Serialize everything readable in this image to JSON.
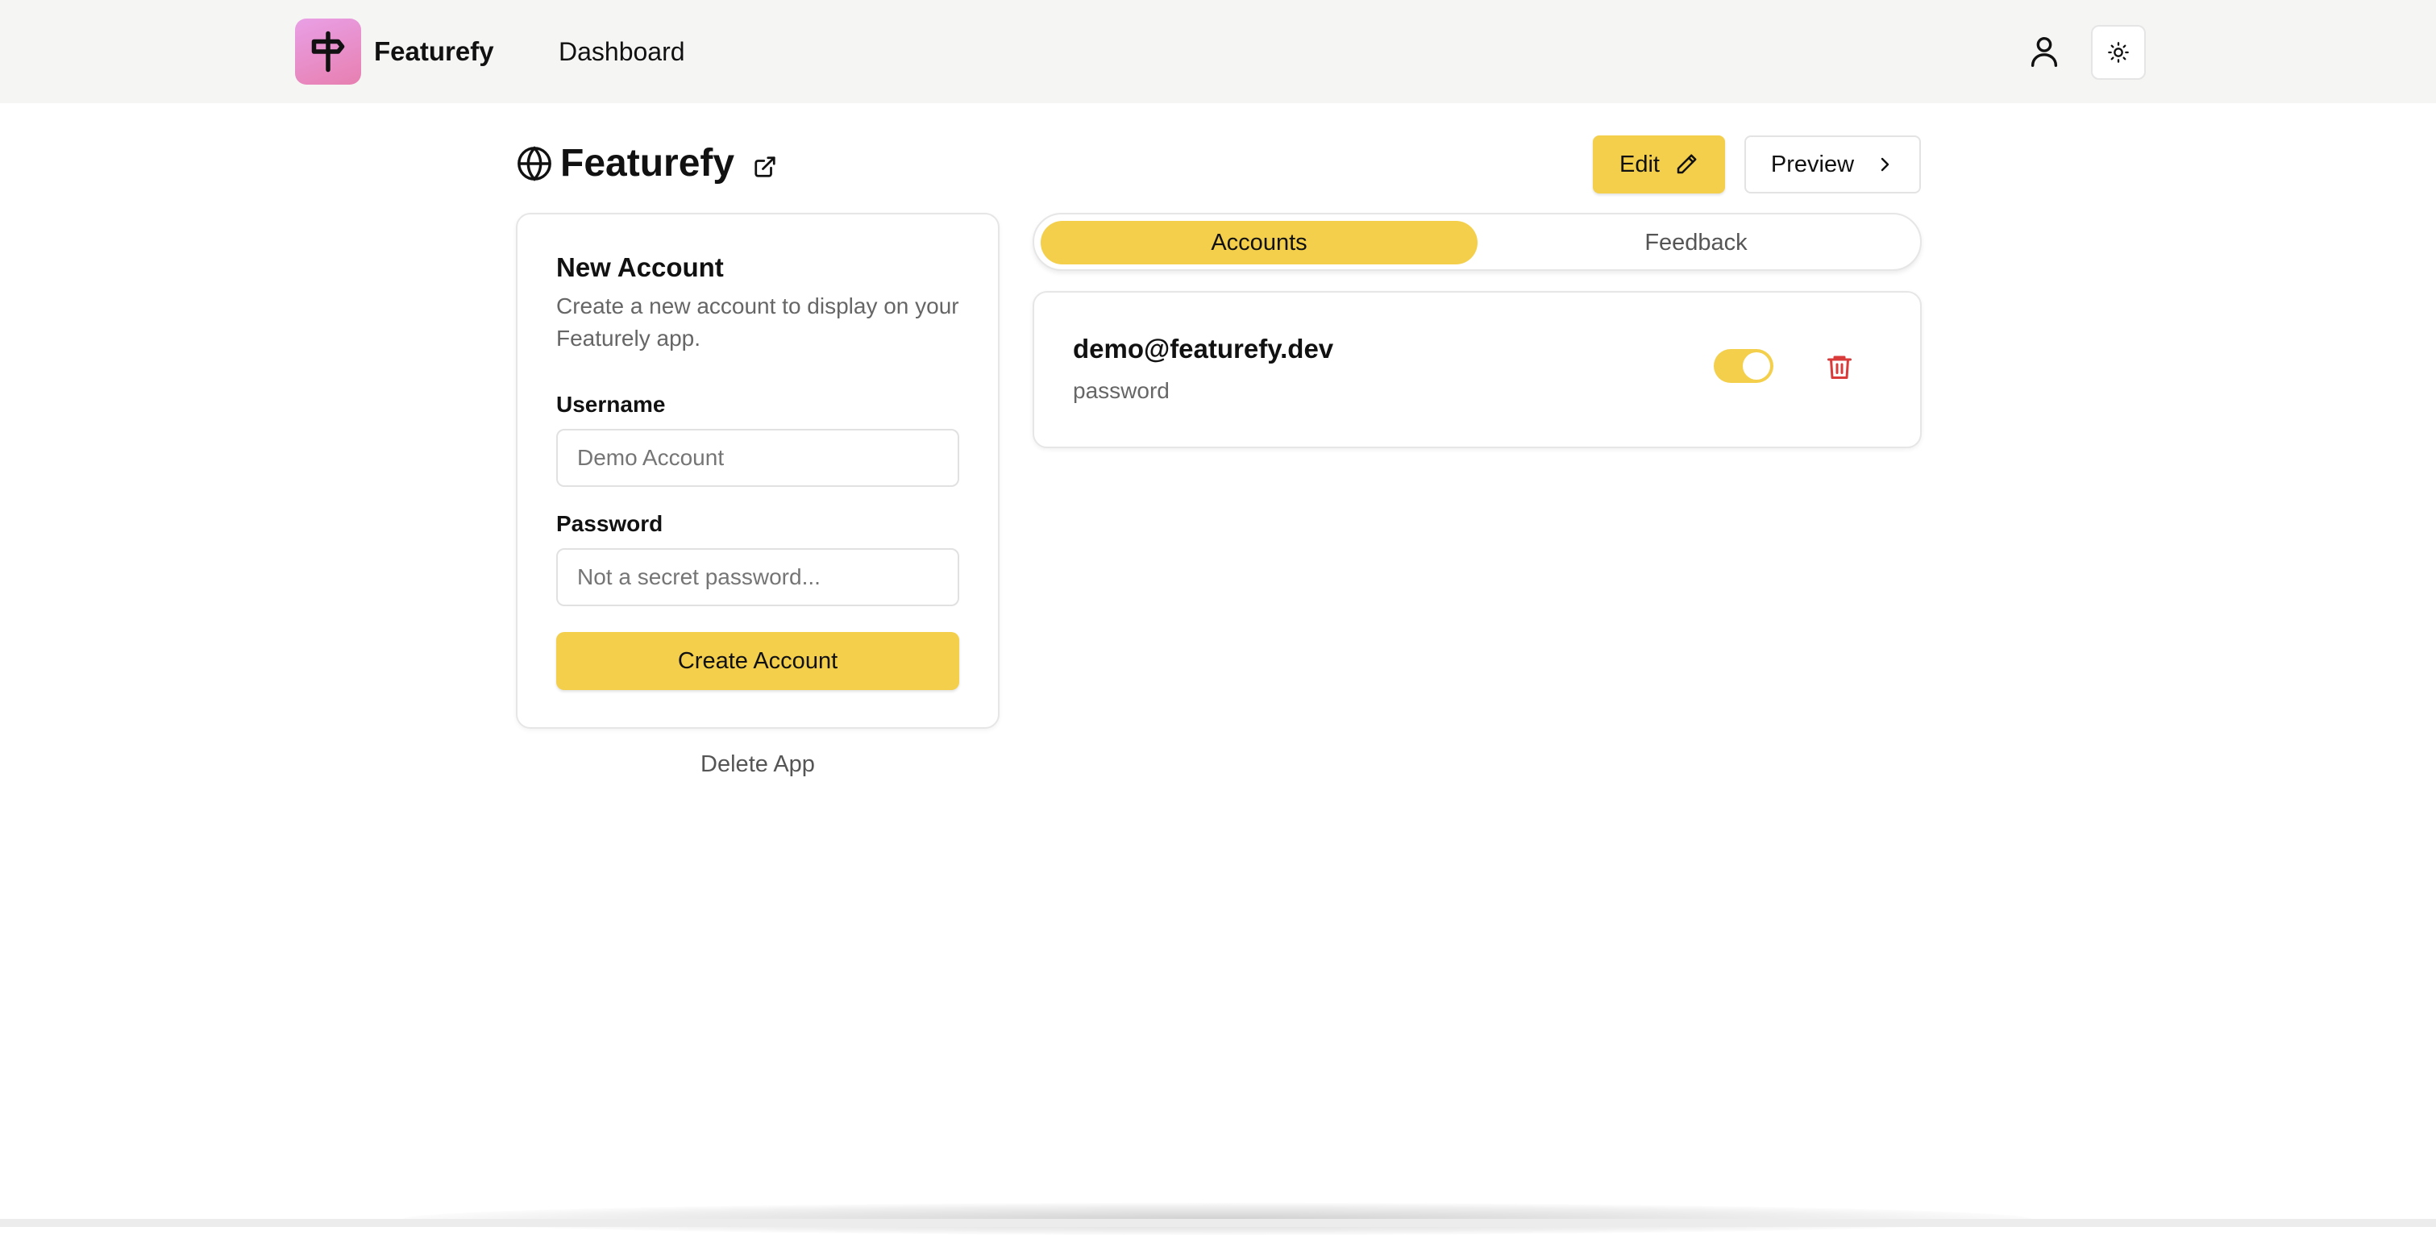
{
  "navbar": {
    "brand": "Featurefy",
    "nav_link": "Dashboard",
    "logo_icon": "signpost-icon",
    "user_icon": "user-icon",
    "theme_icon": "sun-icon"
  },
  "header": {
    "title": "Featurefy",
    "title_icon": "globe-icon",
    "external_icon": "external-link-icon",
    "edit_label": "Edit",
    "edit_icon": "pencil-icon",
    "preview_label": "Preview",
    "preview_icon": "chevron-right-icon"
  },
  "new_account": {
    "title": "New Account",
    "description": "Create a new account to display on your Featurely app.",
    "username_label": "Username",
    "username_placeholder": "Demo Account",
    "username_value": "",
    "password_label": "Password",
    "password_placeholder": "Not a secret password...",
    "password_value": "",
    "create_label": "Create Account"
  },
  "delete_app_label": "Delete App",
  "tabs": [
    {
      "label": "Accounts",
      "active": true
    },
    {
      "label": "Feedback",
      "active": false
    }
  ],
  "accounts": [
    {
      "username": "demo@featurefy.dev",
      "password": "password",
      "enabled": true,
      "delete_icon": "trash-icon"
    }
  ],
  "colors": {
    "accent": "#f3cf4b",
    "logo_gradient_start": "#e9a0e6",
    "logo_gradient_end": "#e77fb0",
    "danger": "#d93a3a"
  }
}
